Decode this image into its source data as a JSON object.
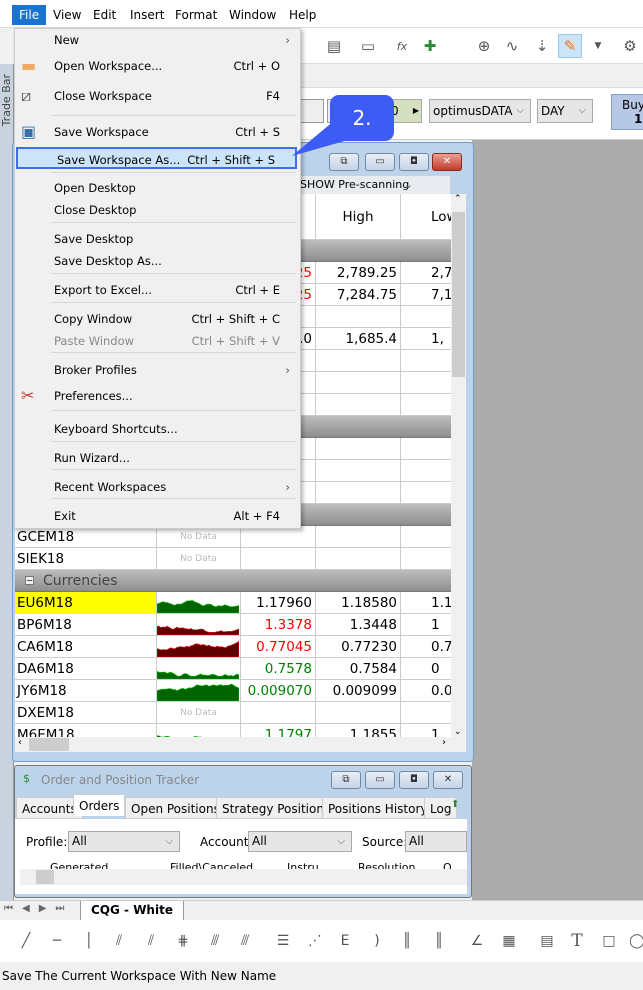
{
  "menubar": {
    "items": [
      "File",
      "View",
      "Edit",
      "Insert",
      "Format",
      "Window",
      "Help"
    ],
    "active": "File"
  },
  "controls": {
    "datasource": "optimusDATA",
    "period": "DAY",
    "buy_label": "Buy",
    "buy_value": "1",
    "field_value": "0"
  },
  "trade_bar_label": "Trade Bar",
  "file_menu": {
    "items": [
      {
        "label": "New",
        "shortcut": "",
        "submenu": true,
        "icon": ""
      },
      {
        "label": "Open Workspace...",
        "shortcut": "Ctrl + O",
        "icon": "folder-icon"
      },
      {
        "label": "Close Workspace",
        "shortcut": "F4",
        "icon": "close-workspace-icon"
      },
      {
        "label": "Save Workspace",
        "shortcut": "Ctrl + S",
        "icon": "save-icon"
      },
      {
        "label": "Save Workspace As...",
        "shortcut": "Ctrl + Shift + S",
        "highlighted": true
      },
      {
        "label": "Open Desktop",
        "shortcut": ""
      },
      {
        "label": "Close Desktop",
        "shortcut": ""
      },
      {
        "label": "Save Desktop",
        "shortcut": ""
      },
      {
        "label": "Save Desktop As...",
        "shortcut": ""
      },
      {
        "label": "Export to Excel...",
        "shortcut": "Ctrl + E"
      },
      {
        "label": "Copy Window",
        "shortcut": "Ctrl + Shift + C"
      },
      {
        "label": "Paste Window",
        "shortcut": "Ctrl + Shift + V",
        "disabled": true
      },
      {
        "label": "Broker Profiles",
        "shortcut": "",
        "submenu": true
      },
      {
        "label": "Preferences...",
        "shortcut": "",
        "icon": "tools-icon"
      },
      {
        "label": "Keyboard Shortcuts...",
        "shortcut": ""
      },
      {
        "label": "Run Wizard...",
        "shortcut": ""
      },
      {
        "label": "Recent Workspaces",
        "shortcut": "",
        "submenu": true
      },
      {
        "label": "Exit",
        "shortcut": "Alt + F4"
      }
    ]
  },
  "callout": "2.",
  "quote_window": {
    "subheader": "SHOW Pre-scanning",
    "columns": [
      "",
      "",
      "",
      "High",
      "Low"
    ],
    "rows": [
      {
        "type": "group",
        "name": ""
      },
      {
        "symbol": "",
        "last": "25",
        "high": "2,789.25",
        "low": "2,7",
        "last_color": "#ff0000"
      },
      {
        "symbol": "",
        "last": "25",
        "high": "7,284.75",
        "low": "7,1",
        "last_color": "#ff0000"
      },
      {
        "symbol": "",
        "last": "",
        "high": "",
        "low": ""
      },
      {
        "symbol": "",
        "last": ".0",
        "high": "1,685.4",
        "low": "1,",
        "last_color": "#000000"
      },
      {
        "symbol": "",
        "last": "",
        "high": "",
        "low": ""
      },
      {
        "symbol": "",
        "last": "",
        "high": "",
        "low": ""
      },
      {
        "symbol": "",
        "last": "",
        "high": "",
        "low": ""
      },
      {
        "type": "group",
        "name": ""
      },
      {
        "symbol": "",
        "last": "",
        "high": "",
        "low": ""
      },
      {
        "symbol": "",
        "last": "",
        "high": "",
        "low": ""
      },
      {
        "symbol": "",
        "last": "",
        "high": "",
        "low": ""
      },
      {
        "type": "group",
        "name": ""
      },
      {
        "symbol": "GCEM18",
        "nodata": "No Data",
        "last": "",
        "high": "",
        "low": ""
      },
      {
        "symbol": "SIEK18",
        "nodata": "No Data",
        "last": "",
        "high": "",
        "low": ""
      },
      {
        "type": "group",
        "name": "Currencies"
      },
      {
        "symbol": "EU6M18",
        "spark": "green",
        "highlight": "#ffff00",
        "last": "1.17960",
        "high": "1.18580",
        "low": "1.1",
        "last_color": "#000000"
      },
      {
        "symbol": "BP6M18",
        "spark": "red",
        "last": "1.3378",
        "high": "1.3448",
        "low": "1",
        "last_color": "#ff0000"
      },
      {
        "symbol": "CA6M18",
        "spark": "red",
        "last": "0.77045",
        "high": "0.77230",
        "low": "0.7",
        "last_color": "#ff0000"
      },
      {
        "symbol": "DA6M18",
        "spark": "green",
        "last": "0.7578",
        "high": "0.7584",
        "low": "0",
        "last_color": "#008000"
      },
      {
        "symbol": "JY6M18",
        "spark": "green",
        "last": "0.009070",
        "high": "0.009099",
        "low": "0.00",
        "last_color": "#008000"
      },
      {
        "symbol": "DXEM18",
        "nodata": "No Data",
        "last": "",
        "high": "",
        "low": ""
      },
      {
        "symbol": "M6EM18",
        "spark": "green",
        "last": "1.1797",
        "high": "1.1855",
        "low": "1",
        "last_color": "#008000"
      }
    ]
  },
  "tracker": {
    "title": "Order and Position Tracker",
    "tabs": [
      "Accounts",
      "Orders",
      "Open Positions",
      "Strategy Positions",
      "Positions History",
      "Log"
    ],
    "active_tab": "Orders",
    "profile_label": "Profile:",
    "profile_value": "All",
    "account_label": "Account:",
    "account_value": "All",
    "source_label": "Source:",
    "source_value": "All",
    "columns": [
      "Generated",
      "Filled\\Canceled",
      "Instru",
      "Resolution",
      "O"
    ]
  },
  "sheet_tab": "CQG - White",
  "status": "Save The Current Workspace With New Name",
  "colors": {
    "accent": "#1a73d0",
    "callout": "#3d5bf5",
    "up": "#008000",
    "down": "#ff0000"
  }
}
